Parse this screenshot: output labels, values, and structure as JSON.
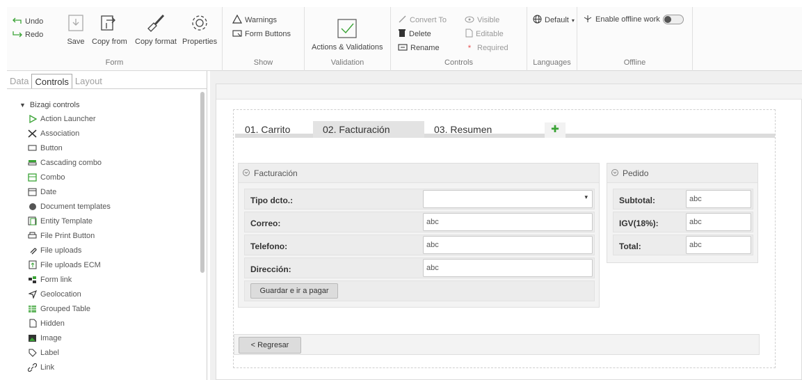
{
  "ribbon": {
    "undo": "Undo",
    "redo": "Redo",
    "save": "Save",
    "copy_from": "Copy from",
    "copy_format": "Copy format",
    "properties": "Properties",
    "group_form": "Form",
    "warnings": "Warnings",
    "form_buttons": "Form Buttons",
    "group_show": "Show",
    "actions_validations": "Actions & Validations",
    "group_validation": "Validation",
    "convert_to": "Convert To",
    "delete": "Delete",
    "rename": "Rename",
    "visible": "Visible",
    "editable": "Editable",
    "required": "Required",
    "group_controls": "Controls",
    "default_lang": "Default",
    "group_languages": "Languages",
    "enable_offline": "Enable offline work",
    "group_offline": "Offline"
  },
  "left_panel": {
    "tabs": [
      "Data",
      "Controls",
      "Layout"
    ],
    "tree_root": "Bizagi controls",
    "items": [
      "Action Launcher",
      "Association",
      "Button",
      "Cascading combo",
      "Combo",
      "Date",
      "Document templates",
      "Entity Template",
      "File Print Button",
      "File uploads",
      "File uploads ECM",
      "Form link",
      "Geolocation",
      "Grouped Table",
      "Hidden",
      "Image",
      "Label",
      "Link"
    ]
  },
  "form": {
    "tabs": [
      "01. Carrito",
      "02. Facturación",
      "03. Resumen"
    ],
    "facturacion": {
      "title": "Facturación",
      "fields": [
        {
          "label": "Tipo dcto.:",
          "value": ""
        },
        {
          "label": "Correo:",
          "value": "abc"
        },
        {
          "label": "Telefono:",
          "value": "abc"
        },
        {
          "label": "Dirección:",
          "value": "abc"
        }
      ],
      "button": "Guardar e ir a pagar"
    },
    "pedido": {
      "title": "Pedido",
      "fields": [
        {
          "label": "Subtotal:",
          "value": "abc"
        },
        {
          "label": "IGV(18%):",
          "value": "abc"
        },
        {
          "label": "Total:",
          "value": "abc"
        }
      ]
    },
    "back_button": "< Regresar"
  },
  "colors": {
    "accent_green": "#3aa335",
    "tab_active": "#e3e3e3"
  }
}
